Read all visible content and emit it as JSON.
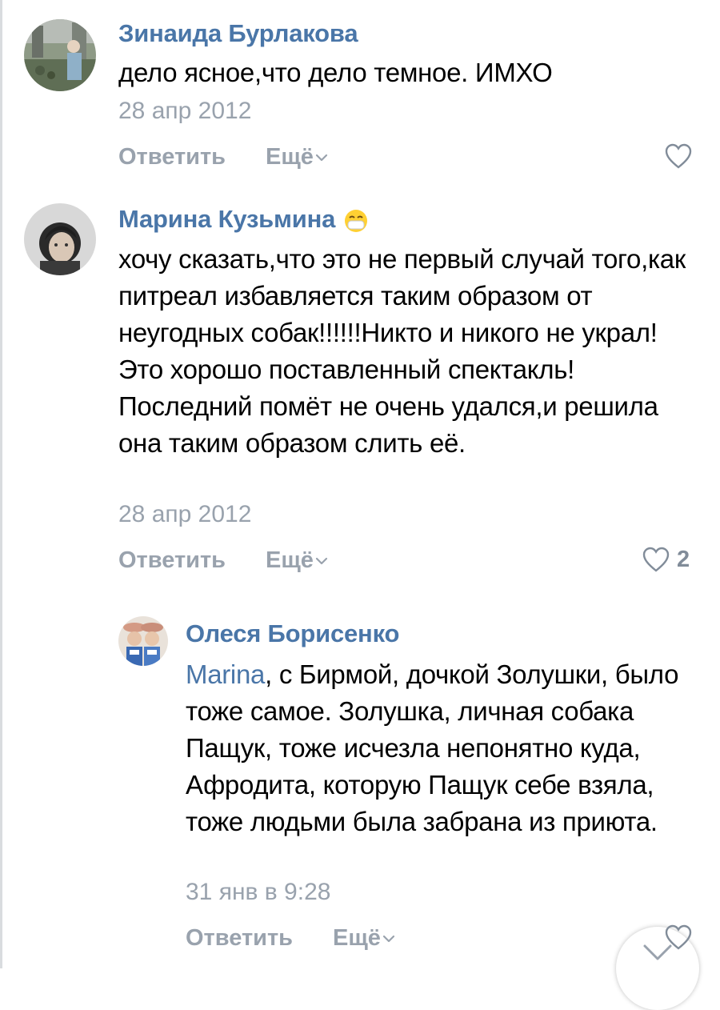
{
  "comments": [
    {
      "author": "Зинаида Бурлакова",
      "text": "дело ясное,что дело темное. ИМХО",
      "date": "28 апр 2012",
      "reply_label": "Ответить",
      "more_label": "Ещё",
      "likes": ""
    },
    {
      "author": "Марина Кузьмина",
      "badge": "emoji-mask-icon",
      "text": "хочу сказать,что это не первый случай того,как питреал избавляется таким образом от неугодных собак!!!!!!Никто и никого не украл!Это хорошо поставленный спектакль!Последний помёт не очень удался,и решила она таким образом слить её.",
      "date": "28 апр 2012",
      "reply_label": "Ответить",
      "more_label": "Ещё",
      "likes": "2"
    },
    {
      "author": "Олеся Борисенко",
      "mention": "Marina",
      "text": ", с Бирмой, дочкой Золушки, было тоже самое. Золушка, личная собака Пащук, тоже исчезла непонятно куда, Афродита, которую Пащук себе взяла, тоже людьми была забрана из приюта.",
      "date": "31 янв в 9:28",
      "reply_label": "Ответить",
      "more_label": "Ещё",
      "likes": ""
    }
  ],
  "colors": {
    "link": "#4a76a8",
    "secondary": "#99a2ad",
    "text": "#000000"
  }
}
